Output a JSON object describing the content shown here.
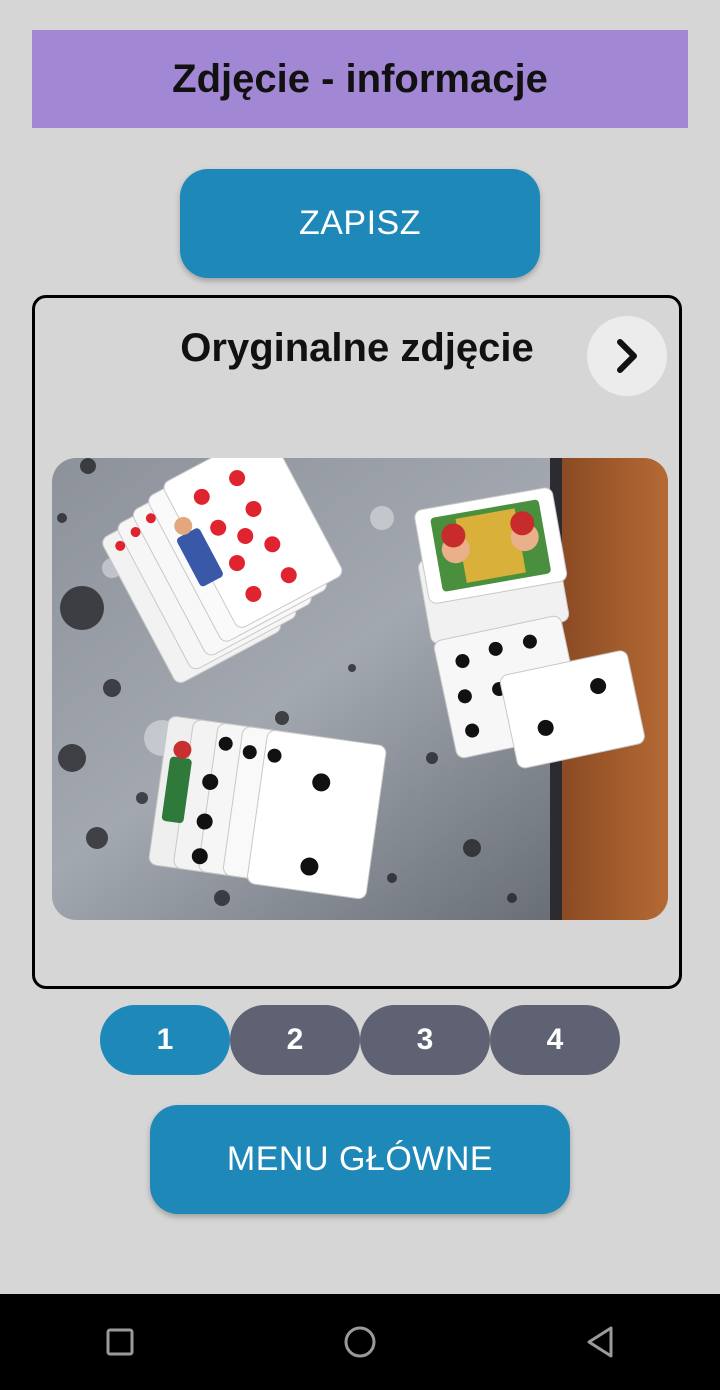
{
  "header": {
    "title": "Zdjęcie - informacje"
  },
  "actions": {
    "save_label": "ZAPISZ",
    "menu_label": "MENU GŁÓWNE"
  },
  "photo_card": {
    "title": "Oryginalne zdjęcie",
    "next_icon": "chevron-right-icon",
    "image_alt": "photo of playing cards on a table"
  },
  "pager": {
    "pages": [
      "1",
      "2",
      "3",
      "4"
    ],
    "active_index": 0
  },
  "system_nav": {
    "recents_icon": "square-icon",
    "home_icon": "circle-icon",
    "back_icon": "triangle-back-icon"
  },
  "colors": {
    "background": "#d6d6d6",
    "title_bar": "#a287d4",
    "primary": "#1e88b9",
    "pill_inactive": "#5e6272"
  }
}
